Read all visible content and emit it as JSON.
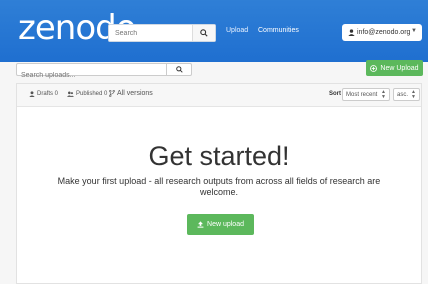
{
  "header": {
    "logo": "zenodo",
    "search_placeholder": "Search",
    "nav": [
      "Upload",
      "Communities"
    ],
    "user_email": "info@zenodo.org"
  },
  "uploads": {
    "search_placeholder": "Search uploads...",
    "new_upload_label": "New Upload"
  },
  "toolbar": {
    "drafts_label": "Drafts 0",
    "published_label": "Published 0",
    "versions_label": "All versions",
    "sort_label": "Sort",
    "sort_value": "Most recent",
    "order_value": "asc."
  },
  "empty_state": {
    "title": "Get started!",
    "message": "Make your first upload - all research outputs from across all fields of research are welcome.",
    "button_label": "New upload"
  },
  "colors": {
    "navbar": "#2f7fd6",
    "success": "#5cb85c"
  }
}
